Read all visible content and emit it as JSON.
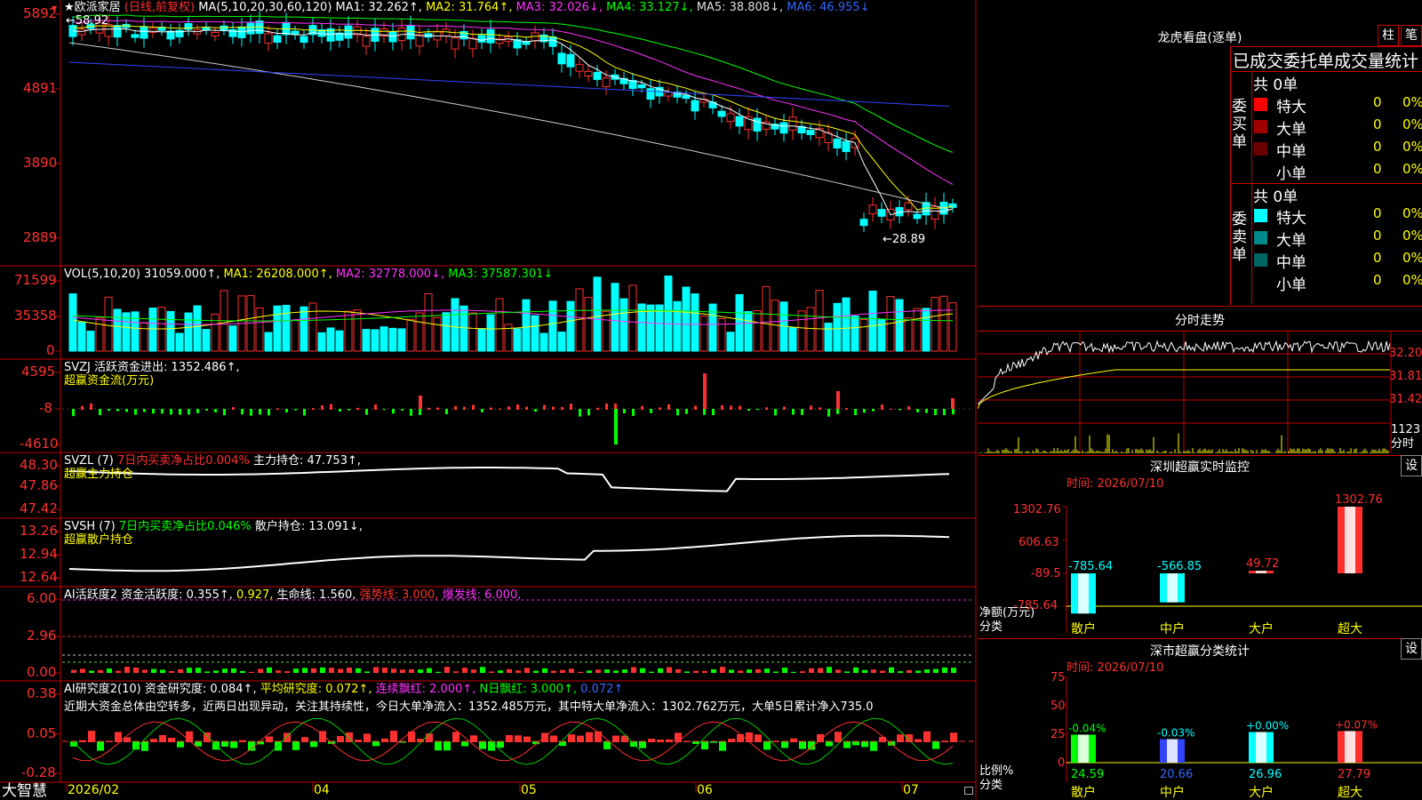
{
  "kline": {
    "high_price": "5892",
    "y_ticks": [
      "5892",
      "4891",
      "3890",
      "2889"
    ],
    "peak_label": "58.92",
    "low_label": "←28.89",
    "header": {
      "stock": "★欧派家居",
      "mode": "(日线,前复权)",
      "ma_params": "MA(5,10,20,30,60,120)",
      "ma1": "MA1: 32.262↑,",
      "ma2": "MA2: 31.764↑,",
      "ma3": "MA3: 32.026↓,",
      "ma4": "MA4: 33.127↓,",
      "ma5": "MA5: 38.808↓,",
      "ma6": "MA6: 46.955↓"
    }
  },
  "volume": {
    "y_ticks": [
      "71599",
      "35358",
      "0"
    ],
    "header": {
      "name": "VOL(5,10,20)",
      "value": "31059.000↑,",
      "ma1": "MA1: 26208.000↑,",
      "ma2": "MA2: 32778.000↓,",
      "ma3": "MA3: 37587.301↓"
    }
  },
  "svzj": {
    "y_ticks": [
      "4595",
      "-8",
      "-4610"
    ],
    "header": {
      "name": "SVZJ",
      "text": "活跃资金进出: 1352.486↑,",
      "sub": "超赢资金流(万元)"
    }
  },
  "svzl": {
    "y_ticks": [
      "48.30",
      "47.86",
      "47.42"
    ],
    "header": {
      "name": "SVZL (7)",
      "text1": "7日内买卖净占比0.004%",
      "text2": "主力持仓: 47.753↑,",
      "sub": "超赢主力持仓"
    }
  },
  "svsh": {
    "y_ticks": [
      "13.26",
      "12.94",
      "12.64"
    ],
    "header": {
      "name": "SVSH (7)",
      "text1": "7日内买卖净占比0.046%",
      "text2": "散户持仓: 13.091↓,",
      "sub": "超赢散户持仓"
    }
  },
  "ai_active": {
    "y_ticks": [
      "6.00",
      "2.96",
      "0.00"
    ],
    "header": {
      "name": "AI活跃度2",
      "t1": "资金活跃度: 0.355↑,",
      "t2": "0.927,",
      "t3": "生命线: 1.560,",
      "t4": "强势线: 3.000,",
      "t5": "爆发线: 6.000,"
    }
  },
  "ai_research": {
    "y_ticks": [
      "0.38",
      "0.05",
      "-0.28"
    ],
    "header": {
      "name": "AI研究度2(10)",
      "t1": "资金研究度: 0.084↑,",
      "t2": "平均研究度: 0.072↑,",
      "t3": "连续飘红: 2.000↑,",
      "t4": "N日飘红: 3.000↑,",
      "t5": "0.072↑"
    },
    "comment": "近期大资金总体由空转多，近两日出现异动，关注其持续性，今日大单净流入：1352.485万元，其中特大单净流入：1302.762万元，大单5日累计净入735.0"
  },
  "x_axis": {
    "labels": [
      "2026/02",
      "04",
      "05",
      "06",
      "07"
    ]
  },
  "footer": {
    "logo": "大智慧"
  },
  "right": {
    "title": "龙虎看盘(逐单)",
    "tab1": "柱",
    "tab2": "笔",
    "stats_title": "已成交委托单成交量统计",
    "buy": {
      "side": "委买单",
      "total": "共 0单",
      "rows": [
        {
          "label": "特大",
          "count": "0",
          "pct": "0%",
          "color": "#ff0000"
        },
        {
          "label": "大单",
          "count": "0",
          "pct": "0%",
          "color": "#a00000"
        },
        {
          "label": "中单",
          "count": "0",
          "pct": "0%",
          "color": "#6a0000"
        },
        {
          "label": "小单",
          "count": "0",
          "pct": "0%",
          "color": "#000000"
        }
      ]
    },
    "sell": {
      "side": "委卖单",
      "total": "共 0单",
      "rows": [
        {
          "label": "特大",
          "count": "0",
          "pct": "0%",
          "color": "#00ffff"
        },
        {
          "label": "大单",
          "count": "0",
          "pct": "0%",
          "color": "#008a8a"
        },
        {
          "label": "中单",
          "count": "0",
          "pct": "0%",
          "color": "#006666"
        },
        {
          "label": "小单",
          "count": "0",
          "pct": "0%",
          "color": "#000000"
        }
      ]
    },
    "intraday": {
      "title": "分时走势",
      "prices": [
        "32.20",
        "31.81",
        "31.42"
      ],
      "vol_label": "1123",
      "vol_unit": "分时"
    },
    "monitor": {
      "title": "深圳超赢实时监控",
      "settings": "设",
      "time": "时间: 2026/07/10",
      "y_ticks": [
        "1302.76",
        "606.63",
        "-89.5",
        "-785.64"
      ],
      "unit_label": "净额(万元)",
      "cat_label": "分类",
      "bars": [
        {
          "cat": "散户",
          "value": -785.64,
          "label": "-785.64"
        },
        {
          "cat": "中户",
          "value": -566.85,
          "label": "-566.85"
        },
        {
          "cat": "大户",
          "value": 49.72,
          "label": "49.72"
        },
        {
          "cat": "超大",
          "value": 1302.76,
          "label": "1302.76"
        }
      ]
    },
    "classify": {
      "title": "深市超赢分类统计",
      "settings": "设",
      "time": "时间: 2026/07/10",
      "y_ticks": [
        "75",
        "50",
        "25",
        "0"
      ],
      "unit_label": "比例%",
      "cat_label": "分类",
      "bars": [
        {
          "cat": "散户",
          "value": 24.59,
          "label": "24.59",
          "change": "-0.04%"
        },
        {
          "cat": "中户",
          "value": 20.66,
          "label": "20.66",
          "change": "-0.03%"
        },
        {
          "cat": "大户",
          "value": 26.96,
          "label": "26.96",
          "change": "+0.00%"
        },
        {
          "cat": "超大",
          "value": 27.79,
          "label": "27.79",
          "change": "+0.07%"
        }
      ]
    }
  }
}
